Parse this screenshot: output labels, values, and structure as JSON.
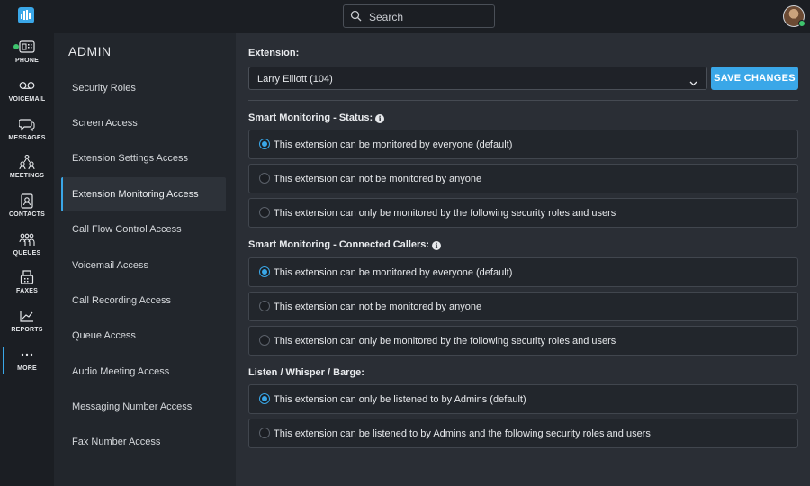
{
  "search": {
    "placeholder": "Search"
  },
  "rail": {
    "items": [
      {
        "label": "PHONE",
        "icon": "phone-icon"
      },
      {
        "label": "VOICEMAIL",
        "icon": "voicemail-icon"
      },
      {
        "label": "MESSAGES",
        "icon": "messages-icon"
      },
      {
        "label": "MEETINGS",
        "icon": "meetings-icon"
      },
      {
        "label": "CONTACTS",
        "icon": "contacts-icon"
      },
      {
        "label": "QUEUES",
        "icon": "queues-icon"
      },
      {
        "label": "FAXES",
        "icon": "fax-icon"
      },
      {
        "label": "REPORTS",
        "icon": "reports-icon"
      },
      {
        "label": "MORE",
        "icon": "more-icon"
      }
    ]
  },
  "sidenav": {
    "title": "ADMIN",
    "items": [
      {
        "label": "Security Roles"
      },
      {
        "label": "Screen Access"
      },
      {
        "label": "Extension Settings Access"
      },
      {
        "label": "Extension Monitoring Access"
      },
      {
        "label": "Call Flow Control Access"
      },
      {
        "label": "Voicemail Access"
      },
      {
        "label": "Call Recording Access"
      },
      {
        "label": "Queue Access"
      },
      {
        "label": "Audio Meeting Access"
      },
      {
        "label": "Messaging Number Access"
      },
      {
        "label": "Fax Number Access"
      }
    ],
    "active_item": "Extension Monitoring Access"
  },
  "main": {
    "extension_label": "Extension:",
    "extension_value": "Larry Elliott (104)",
    "save_label": "SAVE CHANGES",
    "sections": [
      {
        "label": "Smart Monitoring - Status:",
        "info": "i",
        "options": [
          {
            "text": "This extension can be monitored by everyone (default)",
            "selected": true
          },
          {
            "text": "This extension can not be monitored by anyone",
            "selected": false
          },
          {
            "text": "This extension can only be monitored by the following security roles and users",
            "selected": false
          }
        ]
      },
      {
        "label": "Smart Monitoring - Connected Callers:",
        "info": "i",
        "options": [
          {
            "text": "This extension can be monitored by everyone (default)",
            "selected": true
          },
          {
            "text": "This extension can not be monitored by anyone",
            "selected": false
          },
          {
            "text": "This extension can only be monitored by the following security roles and users",
            "selected": false
          }
        ]
      },
      {
        "label": "Listen / Whisper / Barge:",
        "options": [
          {
            "text": "This extension can only be listened to by Admins (default)",
            "selected": true
          },
          {
            "text": "This extension can be listened to by Admins and the following security roles and users",
            "selected": false
          }
        ]
      }
    ]
  },
  "colors": {
    "accent": "#3aa7e8",
    "online": "#3ec46d"
  }
}
